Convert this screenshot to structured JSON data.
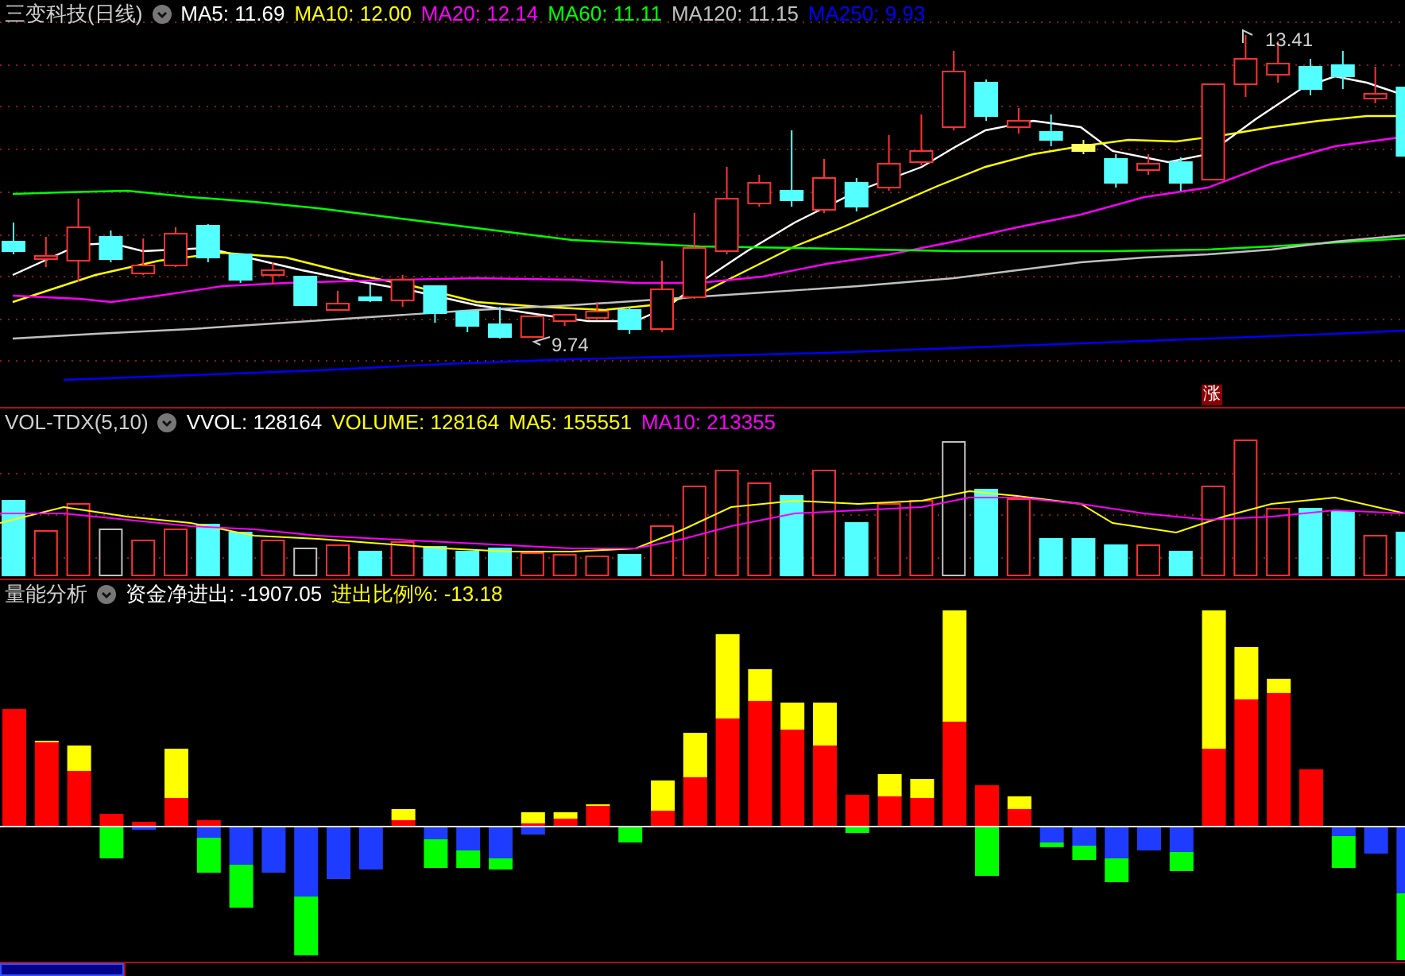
{
  "price_panel": {
    "title": "三变科技(日线)",
    "indicators": [
      {
        "label": "MA5: 11.69",
        "color": "#ffffff"
      },
      {
        "label": "MA10: 12.00",
        "color": "#ffff00"
      },
      {
        "label": "MA20: 12.14",
        "color": "#ff00ff"
      },
      {
        "label": "MA60: 11.11",
        "color": "#00ff00"
      },
      {
        "label": "MA120: 11.15",
        "color": "#c0c0c0"
      },
      {
        "label": "MA250: 9.93",
        "color": "#0000ff"
      }
    ],
    "high_label": "13.41",
    "low_label": "9.74",
    "badge": "涨"
  },
  "volume_panel": {
    "title": "VOL-TDX(5,10)",
    "indicators": [
      {
        "label": "VVOL: 128164",
        "color": "#ffffff"
      },
      {
        "label": "VOLUME: 128164",
        "color": "#ffff00"
      },
      {
        "label": "MA5: 155551",
        "color": "#ffff00"
      },
      {
        "label": "MA10: 213355",
        "color": "#ff00ff"
      }
    ]
  },
  "flow_panel": {
    "title": "量能分析",
    "indicators": [
      {
        "label": "资金净进出: -1907.05",
        "color": "#ffffff"
      },
      {
        "label": "进出比例%: -13.18",
        "color": "#ffff00"
      }
    ]
  }
}
